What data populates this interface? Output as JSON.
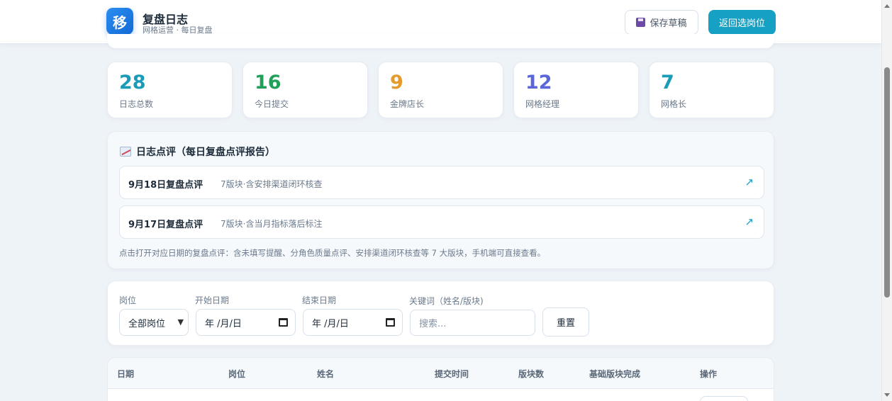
{
  "header": {
    "logo_char": "移",
    "title": "复盘日志",
    "subtitle": "网格运营 · 每日复盘",
    "save_draft_label": "保存草稿",
    "back_label": "返回选岗位",
    "save_icon": "floppy-disk-icon"
  },
  "stats": [
    {
      "value": "28",
      "label": "日志总数",
      "color": "#1a9bb8"
    },
    {
      "value": "16",
      "label": "今日提交",
      "color": "#22a05a"
    },
    {
      "value": "9",
      "label": "金牌店长",
      "color": "#e59a2c"
    },
    {
      "value": "12",
      "label": "网格经理",
      "color": "#5b67d8"
    },
    {
      "value": "7",
      "label": "网格长",
      "color": "#1a9bb8"
    }
  ],
  "review": {
    "title": "日志点评（每日复盘点评报告）",
    "items": [
      {
        "date": "9月18日复盘点评",
        "desc": "7版块·含安排渠道闭环核查",
        "icon": "external-link-arrow"
      },
      {
        "date": "9月17日复盘点评",
        "desc": "7版块·含当月指标落后标注",
        "icon": "external-link-arrow"
      }
    ],
    "note": "点击打开对应日期的复盘点评：含未填写提醒、分角色质量点评、安排渠道闭环核查等 7 大版块，手机端可直接查看。"
  },
  "filters": {
    "role_label": "岗位",
    "role_value": "全部岗位",
    "start_label": "开始日期",
    "start_value": "年 /月/日",
    "end_label": "结束日期",
    "end_value": "年 /月/日",
    "keyword_label": "关键词（姓名/版块)",
    "keyword_placeholder": "搜索...",
    "reset_label": "重置"
  },
  "table": {
    "columns": [
      "日期",
      "岗位",
      "姓名",
      "提交时间",
      "版块数",
      "基础版块完成",
      "操作"
    ]
  },
  "colors": {
    "accent": "#16a1c4",
    "logo": "#1a7be0"
  }
}
